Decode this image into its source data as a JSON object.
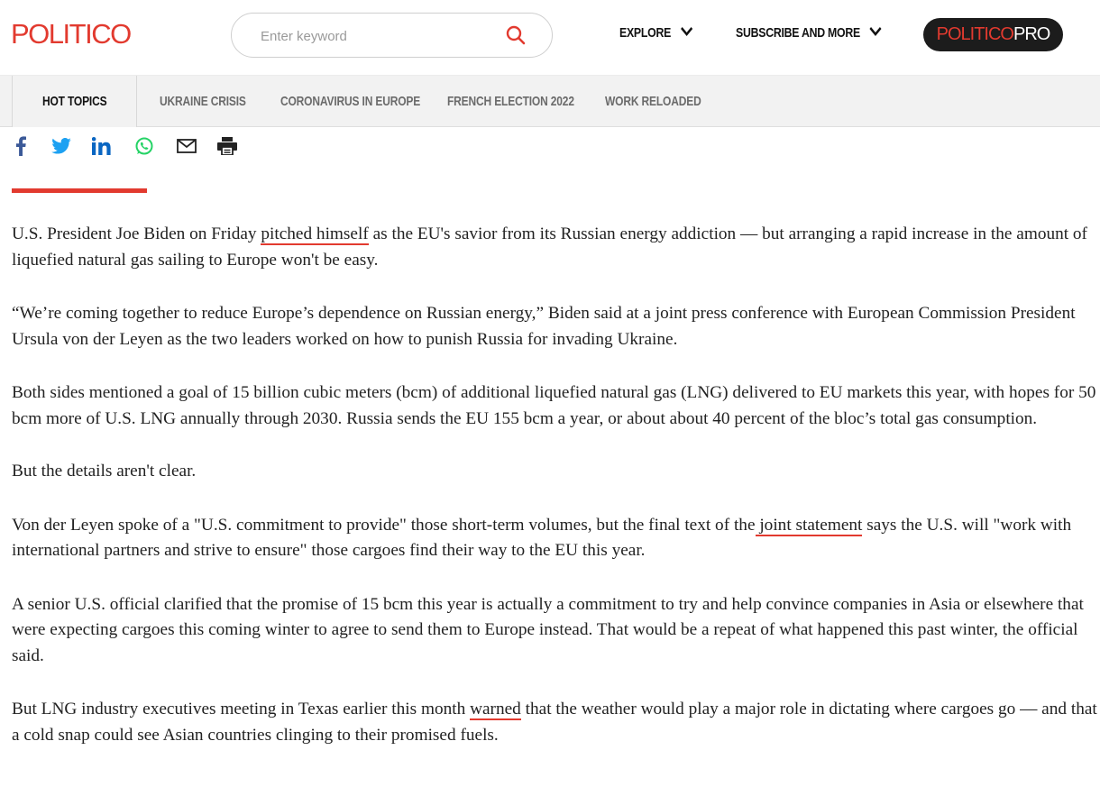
{
  "header": {
    "logo": "POLITICO",
    "search_placeholder": "Enter keyword",
    "explore_label": "EXPLORE",
    "subscribe_label": "SUBSCRIBE AND MORE",
    "pro_politico": "POLITICO",
    "pro_suffix": "PRO"
  },
  "topics": {
    "hot_label": "HOT TOPICS",
    "items": [
      "UKRAINE CRISIS",
      "CORONAVIRUS IN EUROPE",
      "FRENCH ELECTION 2022",
      "WORK RELOADED"
    ]
  },
  "share": {
    "icons": [
      "facebook-icon",
      "twitter-icon",
      "linkedin-icon",
      "whatsapp-icon",
      "email-icon",
      "print-icon"
    ]
  },
  "colors": {
    "brand_red": "#e23a2f",
    "pro_button_bg": "#1c1c1c"
  },
  "article": {
    "p1": {
      "before": "U.S. President Joe Biden on Friday ",
      "link": "pitched himself",
      "after": " as the EU's savior from its Russian energy addiction — but arranging a rapid increase in the amount of liquefied natural gas sailing to Europe won't be easy."
    },
    "p2": "“We’re coming together to reduce Europe’s dependence on Russian energy,” Biden said at a joint press conference with European Commission President Ursula von der Leyen as the two leaders worked on how to punish Russia for invading Ukraine.",
    "p3": "Both sides mentioned a goal of 15 billion cubic meters (bcm) of additional liquefied natural gas (LNG) delivered to EU markets this year, with hopes for 50 bcm more of U.S. LNG annually through 2030. Russia sends the EU 155 bcm a year, or about about 40 percent of the bloc’s total gas consumption.",
    "p4": "But the details aren't clear.",
    "p5": {
      "before": "Von der Leyen spoke of a \"U.S. commitment to provide\" those short-term volumes, but the final text of the",
      "link": " joint statement",
      "after": " says the U.S. will \"work with international partners and strive to ensure\" those cargoes find their way to the EU this year."
    },
    "p6": "A senior U.S. official clarified that the promise of 15 bcm this year is actually a commitment to try and help convince companies in Asia or elsewhere that were expecting cargoes this coming winter to agree to send them to Europe instead. That would be a repeat of what happened this past winter, the official said.",
    "p7": {
      "before": "But LNG industry executives meeting in Texas earlier this month ",
      "link": "warned",
      "after": " that the weather would play a major role in dictating where cargoes go — and that a cold snap could see Asian countries clinging to their promised fuels."
    }
  }
}
